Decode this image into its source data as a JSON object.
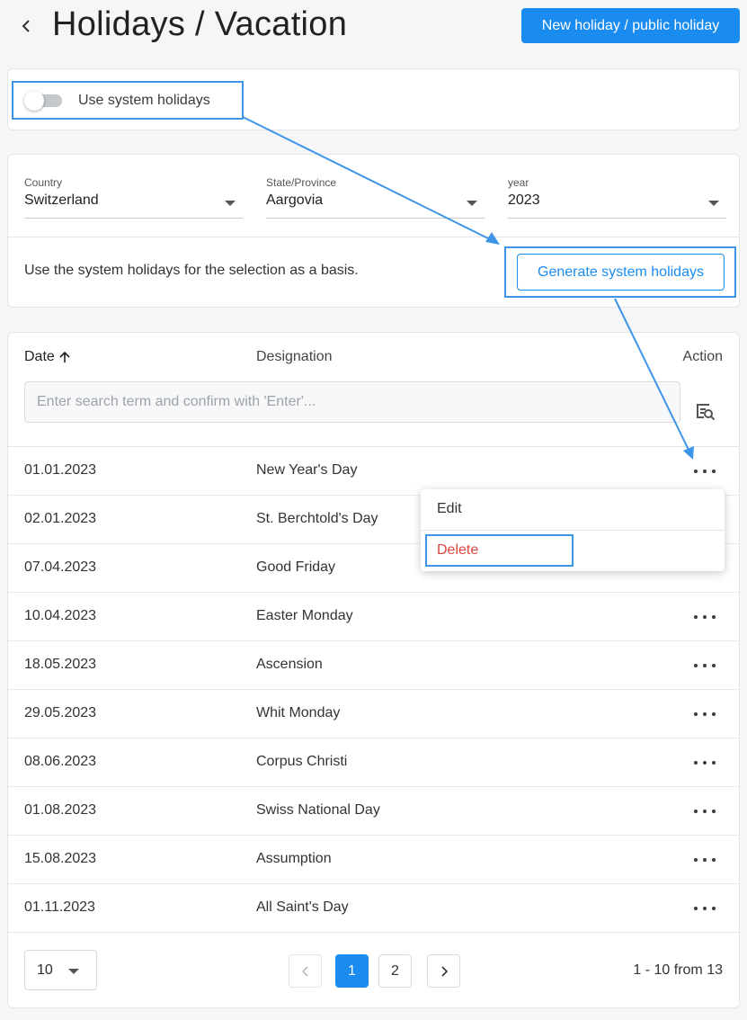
{
  "header": {
    "title": "Holidays / Vacation",
    "new_button": "New holiday / public holiday"
  },
  "toggle": {
    "label": "Use system holidays",
    "on": false
  },
  "filters": {
    "country": {
      "label": "Country",
      "value": "Switzerland"
    },
    "state": {
      "label": "State/Province",
      "value": "Aargovia"
    },
    "year": {
      "label": "year",
      "value": "2023"
    }
  },
  "basis_text": "Use the system holidays for the selection as a basis.",
  "generate_button": "Generate system holidays",
  "table": {
    "headers": {
      "date": "Date",
      "designation": "Designation",
      "action": "Action"
    },
    "search_placeholder": "Enter search term and confirm with 'Enter'...",
    "rows": [
      {
        "date": "01.01.2023",
        "designation": "New Year's Day"
      },
      {
        "date": "02.01.2023",
        "designation": "St. Berchtold's Day"
      },
      {
        "date": "07.04.2023",
        "designation": "Good Friday"
      },
      {
        "date": "10.04.2023",
        "designation": "Easter Monday"
      },
      {
        "date": "18.05.2023",
        "designation": "Ascension"
      },
      {
        "date": "29.05.2023",
        "designation": "Whit Monday"
      },
      {
        "date": "08.06.2023",
        "designation": "Corpus Christi"
      },
      {
        "date": "01.08.2023",
        "designation": "Swiss National Day"
      },
      {
        "date": "15.08.2023",
        "designation": "Assumption"
      },
      {
        "date": "01.11.2023",
        "designation": "All Saint's Day"
      }
    ]
  },
  "context_menu": {
    "edit": "Edit",
    "delete": "Delete"
  },
  "pagination": {
    "page_size": "10",
    "pages": [
      "1",
      "2"
    ],
    "current_page": "1",
    "range_text": "1 - 10 from 13"
  },
  "colors": {
    "primary": "#1a8cf0",
    "danger": "#e0453b",
    "annotation": "#3e95e8"
  }
}
